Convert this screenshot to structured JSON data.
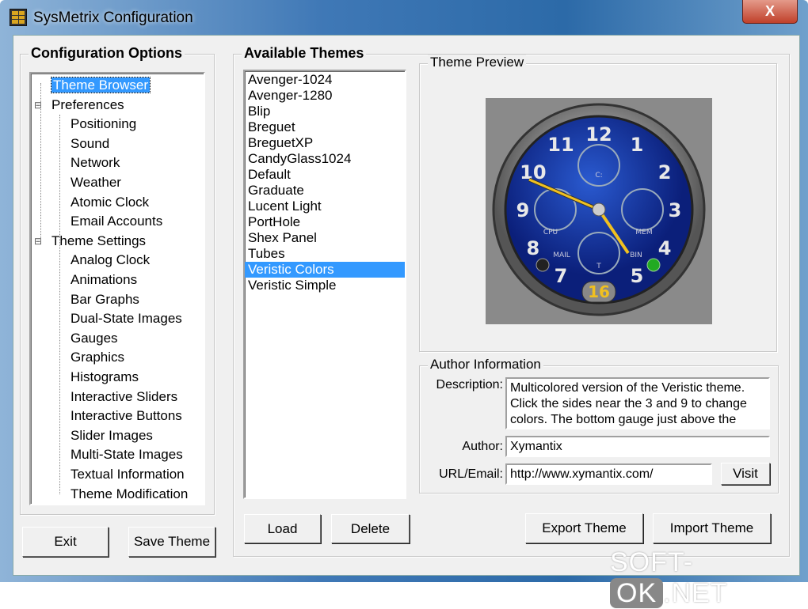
{
  "window": {
    "title": "SysMetrix Configuration",
    "close": "X"
  },
  "config": {
    "title": "Configuration Options",
    "tree": [
      {
        "label": "Theme Browser",
        "level": 0,
        "selected": true
      },
      {
        "label": "Preferences",
        "level": 0,
        "expander": "⊟"
      },
      {
        "label": "Positioning",
        "level": 1
      },
      {
        "label": "Sound",
        "level": 1
      },
      {
        "label": "Network",
        "level": 1
      },
      {
        "label": "Weather",
        "level": 1
      },
      {
        "label": "Atomic Clock",
        "level": 1
      },
      {
        "label": "Email Accounts",
        "level": 1
      },
      {
        "label": "Theme Settings",
        "level": 0,
        "expander": "⊟"
      },
      {
        "label": "Analog Clock",
        "level": 1
      },
      {
        "label": "Animations",
        "level": 1
      },
      {
        "label": "Bar Graphs",
        "level": 1
      },
      {
        "label": "Dual-State Images",
        "level": 1
      },
      {
        "label": "Gauges",
        "level": 1
      },
      {
        "label": "Graphics",
        "level": 1
      },
      {
        "label": "Histograms",
        "level": 1
      },
      {
        "label": "Interactive Sliders",
        "level": 1
      },
      {
        "label": "Interactive Buttons",
        "level": 1
      },
      {
        "label": "Slider Images",
        "level": 1
      },
      {
        "label": "Multi-State Images",
        "level": 1
      },
      {
        "label": "Textual Information",
        "level": 1
      },
      {
        "label": "Theme Modification",
        "level": 1
      }
    ],
    "exit": "Exit",
    "save": "Save Theme"
  },
  "themes": {
    "title": "Available Themes",
    "items": [
      "Avenger-1024",
      "Avenger-1280",
      "Blip",
      "Breguet",
      "BreguetXP",
      "CandyGlass1024",
      "Default",
      "Graduate",
      "Lucent Light",
      "PortHole",
      "Shex Panel",
      "Tubes",
      "Veristic Colors",
      "Veristic Simple"
    ],
    "selected_index": 12,
    "load": "Load",
    "delete": "Delete"
  },
  "preview": {
    "title": "Theme Preview",
    "clock_numbers": [
      "12",
      "1",
      "2",
      "3",
      "4",
      "5",
      "7",
      "8",
      "9",
      "10",
      "11"
    ],
    "date": "16",
    "subdials": [
      "C:",
      "CPU",
      "MEM",
      "T",
      "MAIL",
      "BIN"
    ]
  },
  "author": {
    "title": "Author Information",
    "description_label": "Description:",
    "description": "Multicolored version of the Veristic theme. Click the sides near the 3 and 9 to change colors.  The bottom gauge just above the",
    "author_label": "Author:",
    "author": "Xymantix",
    "url_label": "URL/Email:",
    "url": "http://www.xymantix.com/",
    "visit": "Visit"
  },
  "export": "Export Theme",
  "import": "Import Theme",
  "watermark": {
    "a": "SOFT-",
    "b": "OK",
    ".c": ".NET",
    "c": ".NET"
  }
}
